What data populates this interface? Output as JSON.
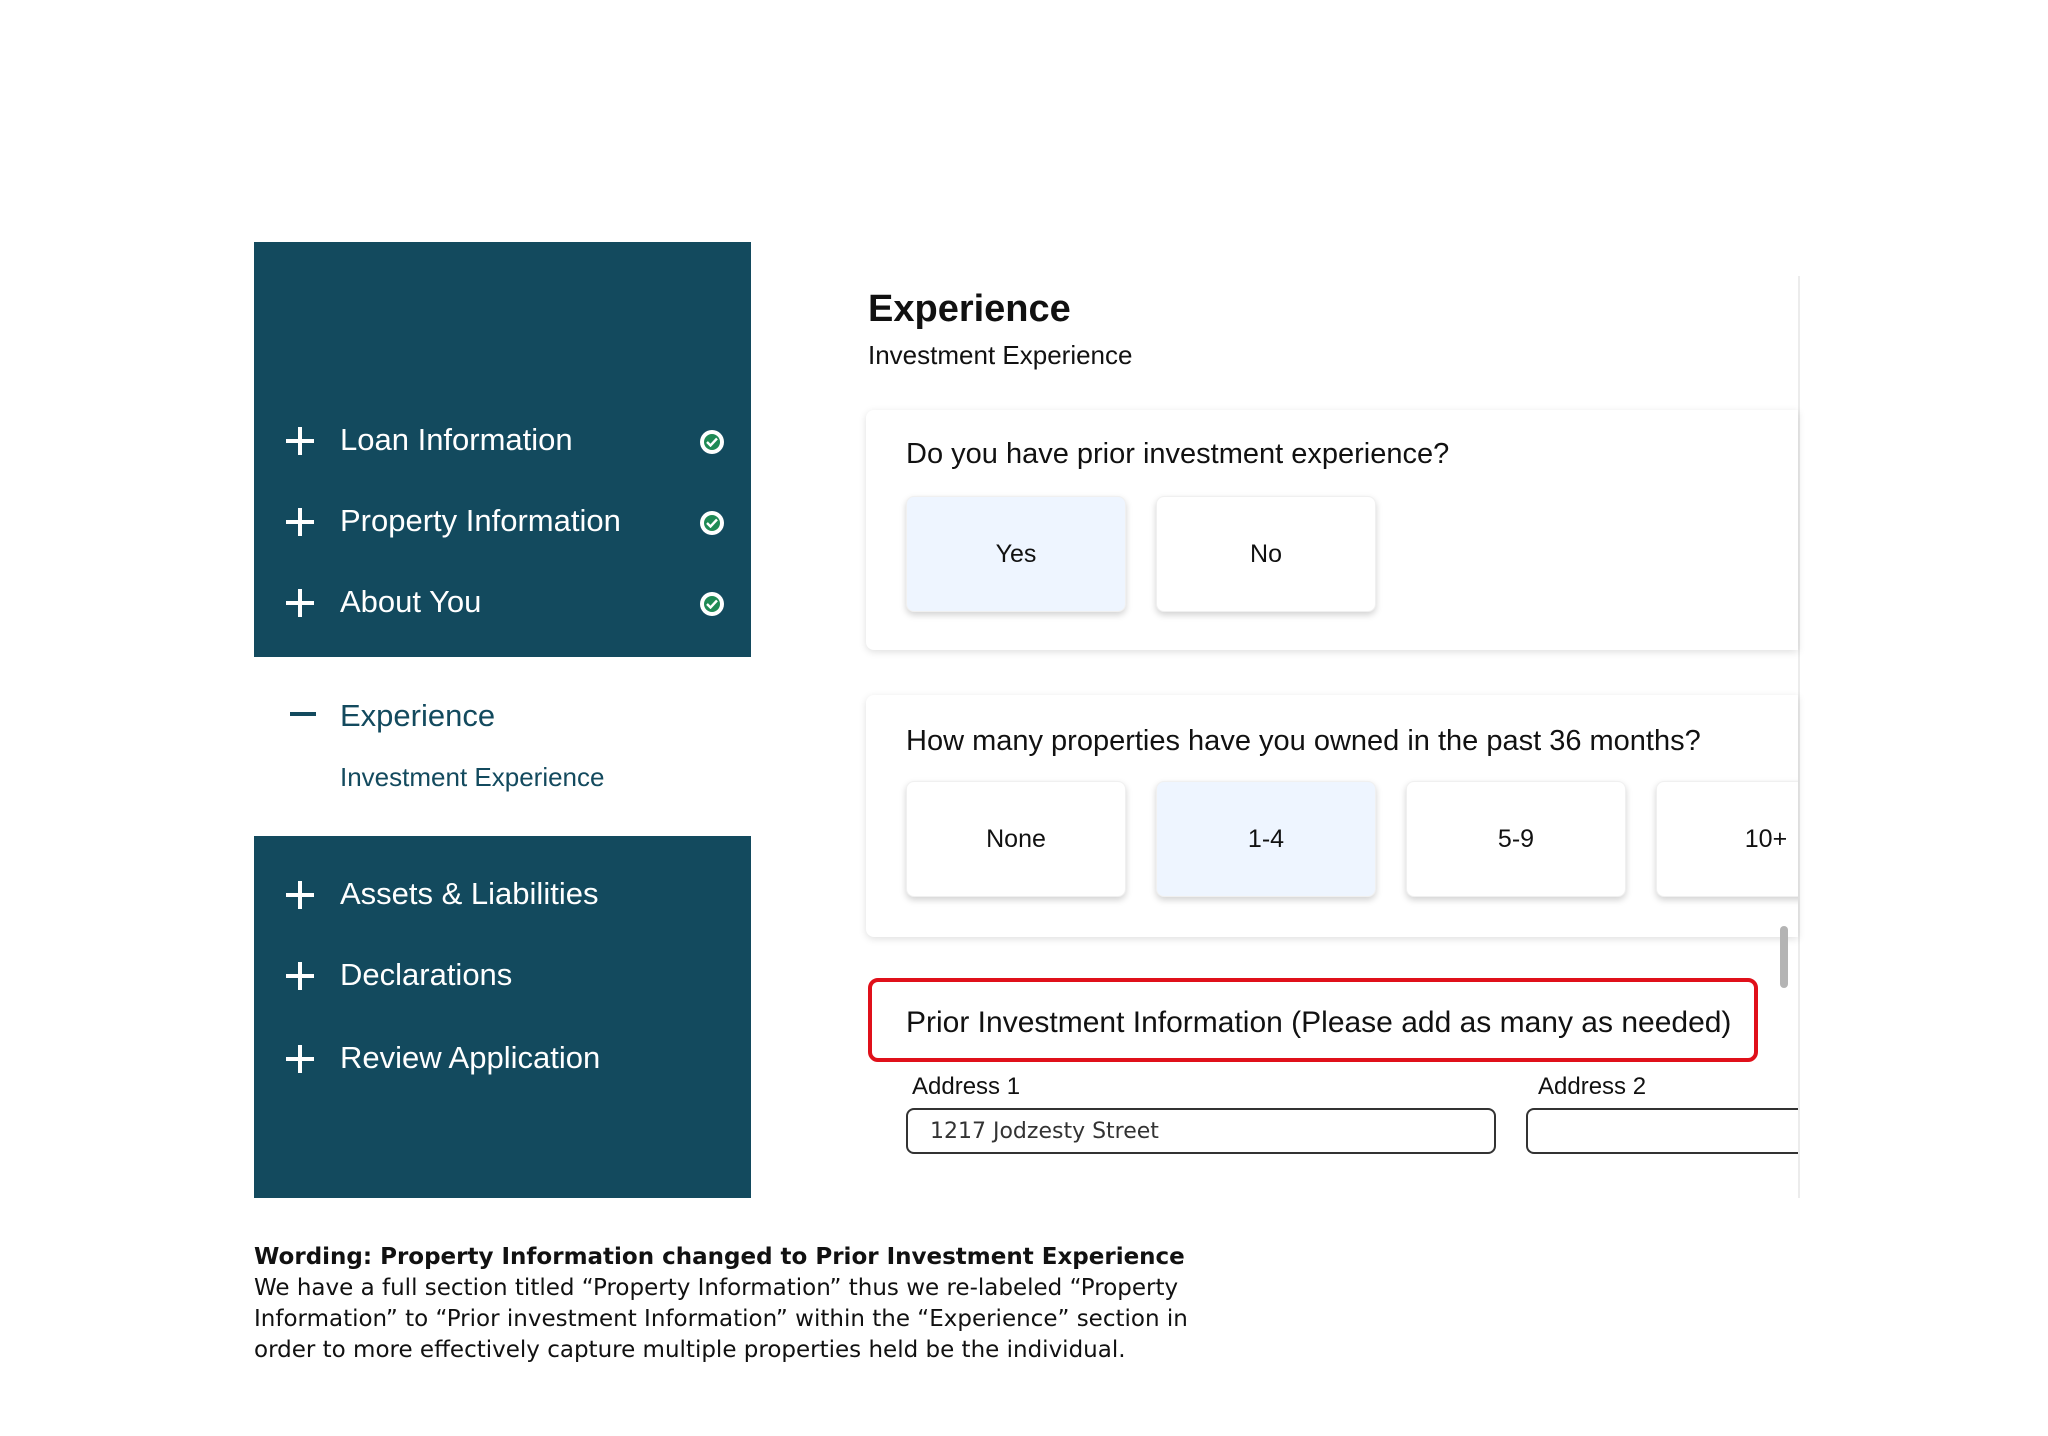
{
  "sidebar": {
    "items_top": [
      {
        "label": "Loan Information",
        "completed": true
      },
      {
        "label": "Property Information",
        "completed": true
      },
      {
        "label": "About You",
        "completed": true
      }
    ],
    "active": {
      "label": "Experience",
      "sub_label": "Investment Experience"
    },
    "items_bottom": [
      {
        "label": "Assets & Liabilities"
      },
      {
        "label": "Declarations"
      },
      {
        "label": "Review Application"
      }
    ],
    "icons": {
      "expand": "plus-icon",
      "collapse": "minus-icon",
      "complete": "check-circle-icon"
    },
    "colors": {
      "background": "#134a5e",
      "check": "#1f8a55"
    }
  },
  "main": {
    "title": "Experience",
    "subtitle": "Investment Experience",
    "q1": {
      "question": "Do you have prior investment experience?",
      "options": [
        "Yes",
        "No"
      ],
      "selected": "Yes"
    },
    "q2": {
      "question": "How many properties have you owned in the past 36 months?",
      "options": [
        "None",
        "1-4",
        "5-9",
        "10+"
      ],
      "selected": "1-4"
    },
    "section_heading": "Prior Investment Information (Please add as many as needed)",
    "address1": {
      "label": "Address 1",
      "value": "1217 Jodzesty Street"
    },
    "address2": {
      "label": "Address 2",
      "value": ""
    },
    "colors": {
      "selected_option": "#eef5ff",
      "highlight": "#e0101a"
    }
  },
  "note": {
    "title": "Wording: Property Information changed to Prior Investment Experience",
    "body": "We have a full section titled “Property Information” thus we re-labeled “Property Information” to “Prior investment Information” within the “Experience” section in order to more effectively capture multiple properties held be the individual."
  }
}
